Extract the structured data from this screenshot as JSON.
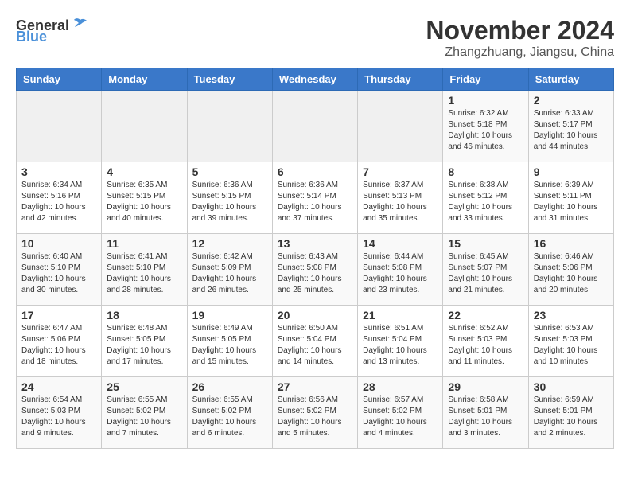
{
  "logo": {
    "general": "General",
    "blue": "Blue"
  },
  "title": "November 2024",
  "location": "Zhangzhuang, Jiangsu, China",
  "headers": [
    "Sunday",
    "Monday",
    "Tuesday",
    "Wednesday",
    "Thursday",
    "Friday",
    "Saturday"
  ],
  "weeks": [
    [
      {
        "day": "",
        "info": ""
      },
      {
        "day": "",
        "info": ""
      },
      {
        "day": "",
        "info": ""
      },
      {
        "day": "",
        "info": ""
      },
      {
        "day": "",
        "info": ""
      },
      {
        "day": "1",
        "info": "Sunrise: 6:32 AM\nSunset: 5:18 PM\nDaylight: 10 hours and 46 minutes."
      },
      {
        "day": "2",
        "info": "Sunrise: 6:33 AM\nSunset: 5:17 PM\nDaylight: 10 hours and 44 minutes."
      }
    ],
    [
      {
        "day": "3",
        "info": "Sunrise: 6:34 AM\nSunset: 5:16 PM\nDaylight: 10 hours and 42 minutes."
      },
      {
        "day": "4",
        "info": "Sunrise: 6:35 AM\nSunset: 5:15 PM\nDaylight: 10 hours and 40 minutes."
      },
      {
        "day": "5",
        "info": "Sunrise: 6:36 AM\nSunset: 5:15 PM\nDaylight: 10 hours and 39 minutes."
      },
      {
        "day": "6",
        "info": "Sunrise: 6:36 AM\nSunset: 5:14 PM\nDaylight: 10 hours and 37 minutes."
      },
      {
        "day": "7",
        "info": "Sunrise: 6:37 AM\nSunset: 5:13 PM\nDaylight: 10 hours and 35 minutes."
      },
      {
        "day": "8",
        "info": "Sunrise: 6:38 AM\nSunset: 5:12 PM\nDaylight: 10 hours and 33 minutes."
      },
      {
        "day": "9",
        "info": "Sunrise: 6:39 AM\nSunset: 5:11 PM\nDaylight: 10 hours and 31 minutes."
      }
    ],
    [
      {
        "day": "10",
        "info": "Sunrise: 6:40 AM\nSunset: 5:10 PM\nDaylight: 10 hours and 30 minutes."
      },
      {
        "day": "11",
        "info": "Sunrise: 6:41 AM\nSunset: 5:10 PM\nDaylight: 10 hours and 28 minutes."
      },
      {
        "day": "12",
        "info": "Sunrise: 6:42 AM\nSunset: 5:09 PM\nDaylight: 10 hours and 26 minutes."
      },
      {
        "day": "13",
        "info": "Sunrise: 6:43 AM\nSunset: 5:08 PM\nDaylight: 10 hours and 25 minutes."
      },
      {
        "day": "14",
        "info": "Sunrise: 6:44 AM\nSunset: 5:08 PM\nDaylight: 10 hours and 23 minutes."
      },
      {
        "day": "15",
        "info": "Sunrise: 6:45 AM\nSunset: 5:07 PM\nDaylight: 10 hours and 21 minutes."
      },
      {
        "day": "16",
        "info": "Sunrise: 6:46 AM\nSunset: 5:06 PM\nDaylight: 10 hours and 20 minutes."
      }
    ],
    [
      {
        "day": "17",
        "info": "Sunrise: 6:47 AM\nSunset: 5:06 PM\nDaylight: 10 hours and 18 minutes."
      },
      {
        "day": "18",
        "info": "Sunrise: 6:48 AM\nSunset: 5:05 PM\nDaylight: 10 hours and 17 minutes."
      },
      {
        "day": "19",
        "info": "Sunrise: 6:49 AM\nSunset: 5:05 PM\nDaylight: 10 hours and 15 minutes."
      },
      {
        "day": "20",
        "info": "Sunrise: 6:50 AM\nSunset: 5:04 PM\nDaylight: 10 hours and 14 minutes."
      },
      {
        "day": "21",
        "info": "Sunrise: 6:51 AM\nSunset: 5:04 PM\nDaylight: 10 hours and 13 minutes."
      },
      {
        "day": "22",
        "info": "Sunrise: 6:52 AM\nSunset: 5:03 PM\nDaylight: 10 hours and 11 minutes."
      },
      {
        "day": "23",
        "info": "Sunrise: 6:53 AM\nSunset: 5:03 PM\nDaylight: 10 hours and 10 minutes."
      }
    ],
    [
      {
        "day": "24",
        "info": "Sunrise: 6:54 AM\nSunset: 5:03 PM\nDaylight: 10 hours and 9 minutes."
      },
      {
        "day": "25",
        "info": "Sunrise: 6:55 AM\nSunset: 5:02 PM\nDaylight: 10 hours and 7 minutes."
      },
      {
        "day": "26",
        "info": "Sunrise: 6:55 AM\nSunset: 5:02 PM\nDaylight: 10 hours and 6 minutes."
      },
      {
        "day": "27",
        "info": "Sunrise: 6:56 AM\nSunset: 5:02 PM\nDaylight: 10 hours and 5 minutes."
      },
      {
        "day": "28",
        "info": "Sunrise: 6:57 AM\nSunset: 5:02 PM\nDaylight: 10 hours and 4 minutes."
      },
      {
        "day": "29",
        "info": "Sunrise: 6:58 AM\nSunset: 5:01 PM\nDaylight: 10 hours and 3 minutes."
      },
      {
        "day": "30",
        "info": "Sunrise: 6:59 AM\nSunset: 5:01 PM\nDaylight: 10 hours and 2 minutes."
      }
    ]
  ]
}
